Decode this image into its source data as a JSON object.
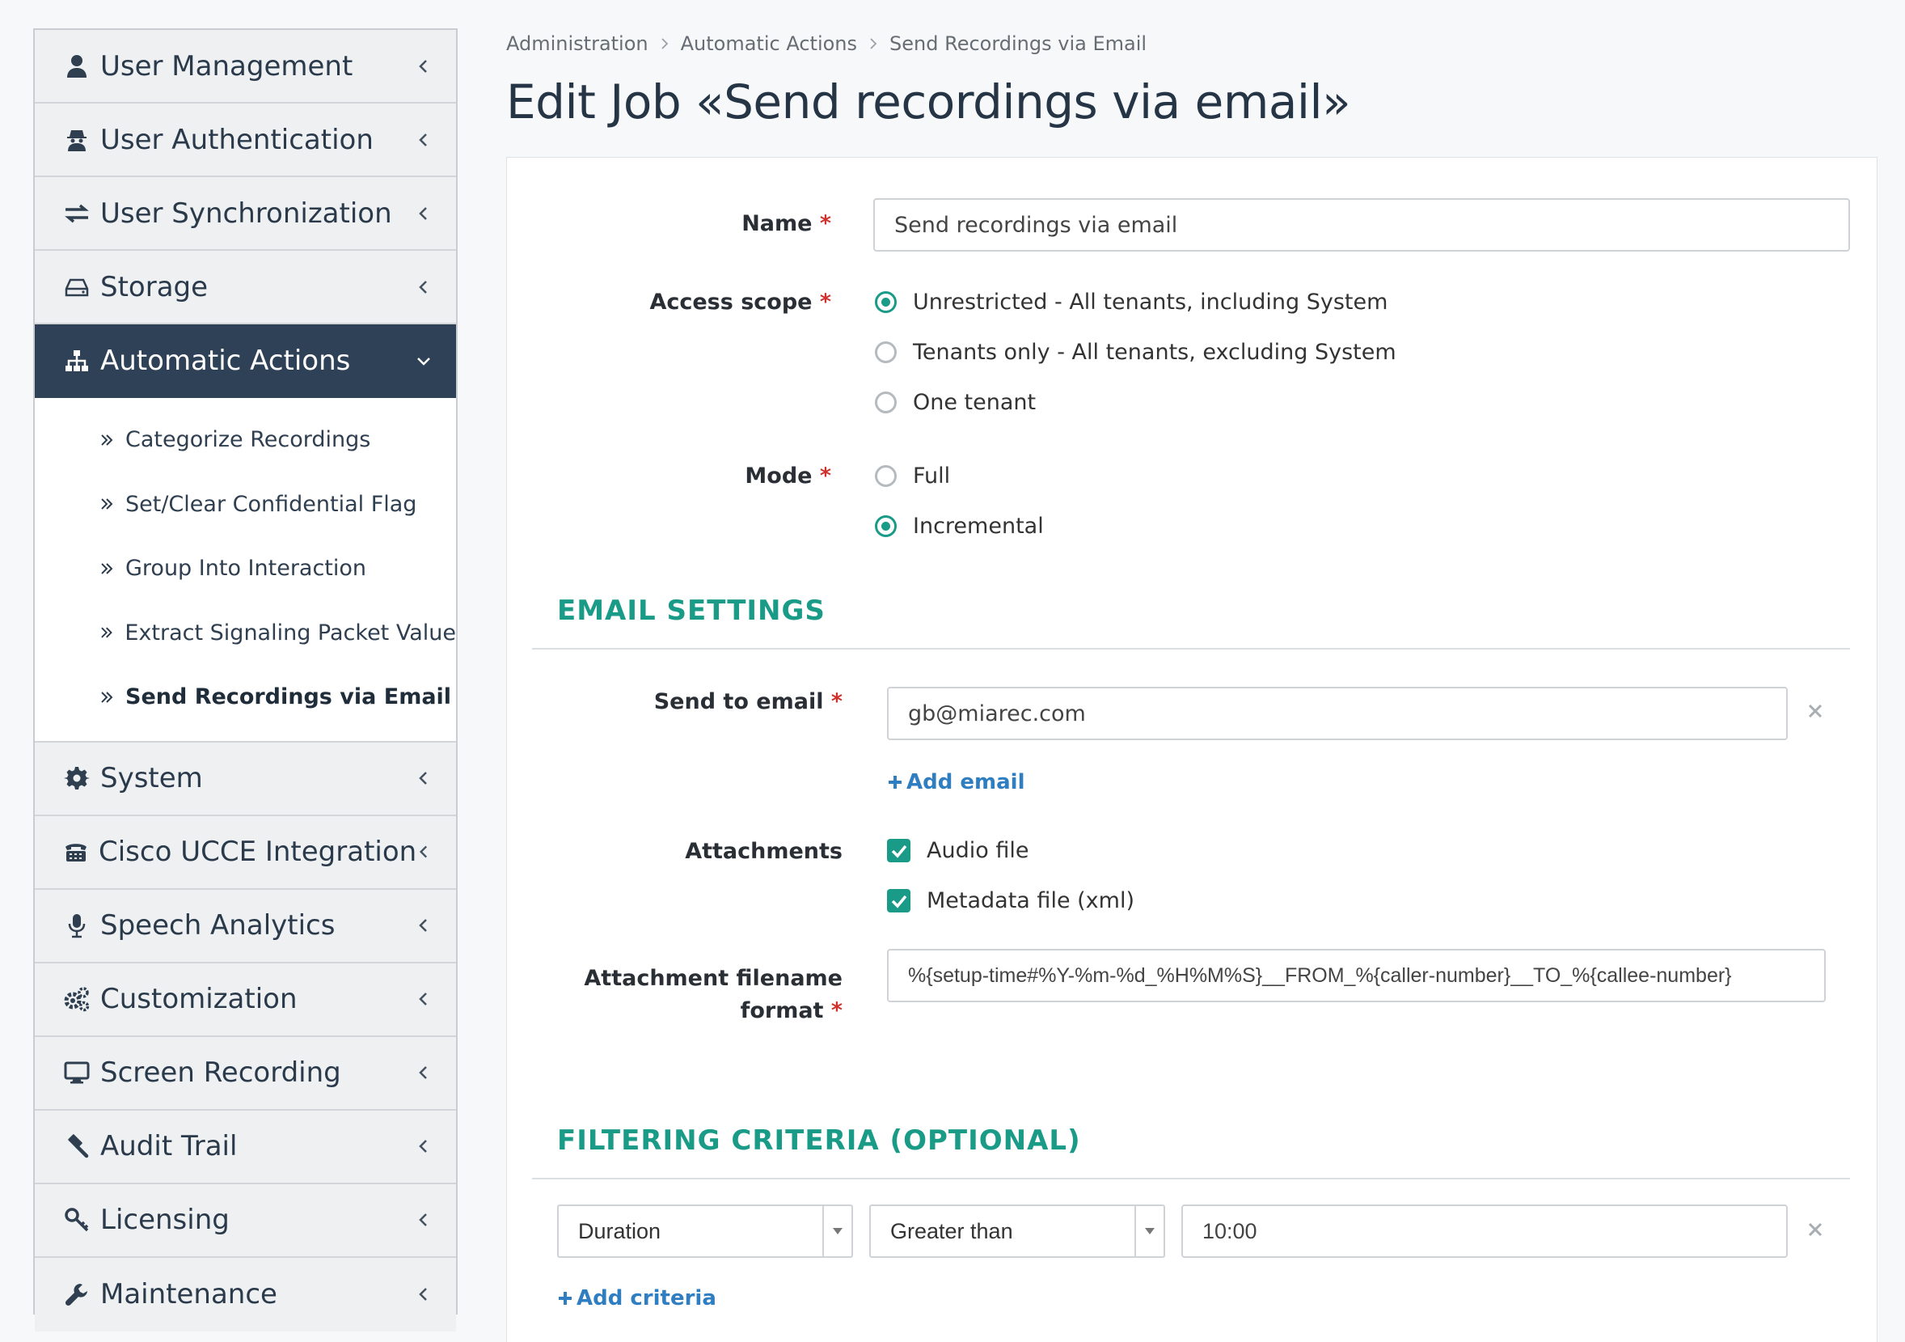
{
  "sidebar": {
    "items": [
      {
        "label": "User Management",
        "icon": "user-icon"
      },
      {
        "label": "User Authentication",
        "icon": "user-secret-icon"
      },
      {
        "label": "User Synchronization",
        "icon": "exchange-icon"
      },
      {
        "label": "Storage",
        "icon": "hdd-icon"
      },
      {
        "label": "Automatic Actions",
        "icon": "sitemap-icon",
        "active": true
      },
      {
        "label": "System",
        "icon": "gear-icon"
      },
      {
        "label": "Cisco UCCE Integration",
        "icon": "fax-icon"
      },
      {
        "label": "Speech Analytics",
        "icon": "microphone-icon"
      },
      {
        "label": "Customization",
        "icon": "gears-icon"
      },
      {
        "label": "Screen Recording",
        "icon": "desktop-icon"
      },
      {
        "label": "Audit Trail",
        "icon": "gavel-icon"
      },
      {
        "label": "Licensing",
        "icon": "key-icon"
      },
      {
        "label": "Maintenance",
        "icon": "wrench-icon"
      }
    ],
    "subitems": [
      {
        "label": "Categorize Recordings"
      },
      {
        "label": "Set/Clear Confidential Flag"
      },
      {
        "label": "Group Into Interaction"
      },
      {
        "label": "Extract Signaling Packet Value"
      },
      {
        "label": "Send Recordings via Email",
        "current": true
      }
    ]
  },
  "breadcrumb": {
    "items": [
      "Administration",
      "Automatic Actions",
      "Send Recordings via Email"
    ]
  },
  "page": {
    "title": "Edit Job «Send recordings via email»"
  },
  "form": {
    "name": {
      "label": "Name",
      "value": "Send recordings via email"
    },
    "access_scope": {
      "label": "Access scope",
      "options": [
        "Unrestricted - All tenants, including System",
        "Tenants only - All tenants, excluding System",
        "One tenant"
      ],
      "selected": 0
    },
    "mode": {
      "label": "Mode",
      "options": [
        "Full",
        "Incremental"
      ],
      "selected": 1
    }
  },
  "email_settings": {
    "title": "EMAIL  SETTINGS",
    "send_to_label": "Send to email",
    "send_to_value": "gb@miarec.com",
    "add_email": "Add email",
    "attachments_label": "Attachments",
    "attachments": [
      "Audio file",
      "Metadata file (xml)"
    ],
    "filename_label_line1": "Attachment filename",
    "filename_label_line2": "format",
    "filename_value": "%{setup-time#%Y-%m-%d_%H%M%S}__FROM_%{caller-number}__TO_%{callee-number}"
  },
  "filtering": {
    "title": "FILTERING  CRITERIA  (OPTIONAL)",
    "field": "Duration",
    "operator": "Greater than",
    "value": "10:00",
    "add_criteria": "Add criteria"
  },
  "required_marker": "*",
  "colors": {
    "accent": "#1a9b87",
    "active_nav": "#2e4156",
    "link": "#2f7ec1",
    "required": "#d0312d"
  }
}
